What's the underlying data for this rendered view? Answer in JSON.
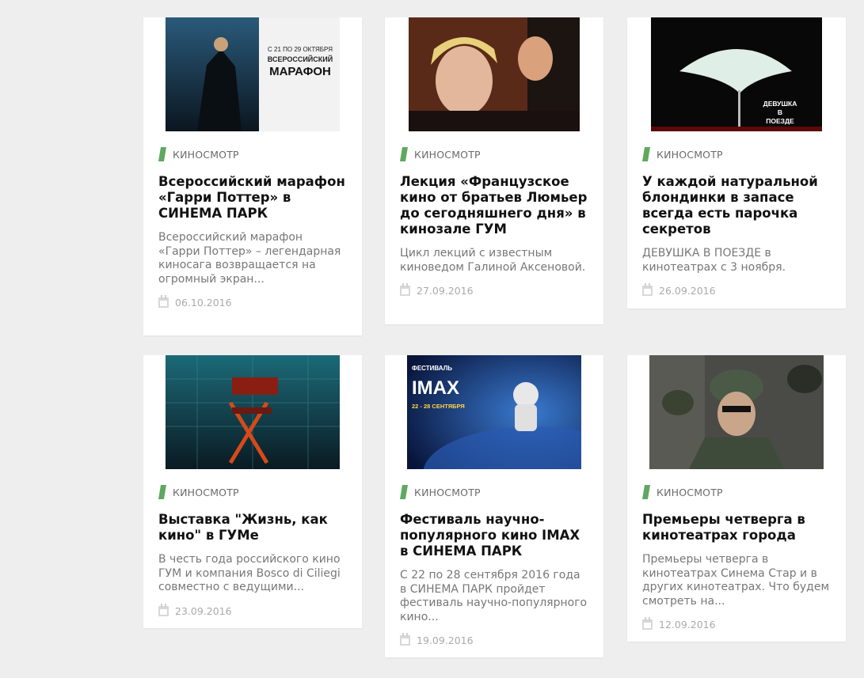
{
  "articles": [
    {
      "category": "КИНОСМОТР",
      "title": "Всероссийский марафон «Гарри Поттер» в СИНЕМА ПАРК",
      "description": "Всероссийский марафон «Гарри Поттер» – легендарная киносага возвращается на огромный экран...",
      "date": "06.10.2016",
      "image": {
        "line1": "С 21 ПО 29 ОКТЯБРЯ",
        "line2": "ВСЕРОССИЙСКИЙ",
        "line3": "МАРАФОН"
      }
    },
    {
      "category": "КИНОСМОТР",
      "title": "Лекция «Французское кино от братьев Люмьер до сегодняшнего дня» в кинозале ГУМ",
      "description": "Цикл лекций с известным киноведом Галиной Аксеновой.",
      "date": "27.09.2016"
    },
    {
      "category": "КИНОСМОТР",
      "title": "У каждой натуральной блондинки в запасе всегда есть парочка секретов",
      "description": "ДЕВУШКА В ПОЕЗДЕ в кинотеатрах с 3 ноября.",
      "date": "26.09.2016",
      "image": {
        "line1": "ДЕВУШКА",
        "line2": "В",
        "line3": "ПОЕЗДЕ"
      }
    },
    {
      "category": "КИНОСМОТР",
      "title": "Выставка \"Жизнь, как кино\" в ГУМе",
      "description": "В честь года российского кино ГУМ и компания Bosco di Ciliegi совместно с ведущими...",
      "date": "23.09.2016"
    },
    {
      "category": "КИНОСМОТР",
      "title": "Фестиваль научно-популярного кино IMAX в СИНЕМА ПАРК",
      "description": "С 22 по 28 сентября 2016 года в СИНЕМА ПАРК пройдет фестиваль научно-популярного кино...",
      "date": "19.09.2016",
      "image": {
        "line1": "ФЕСТИВАЛЬ",
        "line2": "IMAX",
        "line3": "22 - 28 СЕНТЯБРЯ"
      }
    },
    {
      "category": "КИНОСМОТР",
      "title": "Премьеры четверга в кинотеатрах города",
      "description": "Премьеры четверга в кинотеатрах Синема Стар и в других кинотеатрах. Что будем смотреть на...",
      "date": "12.09.2016"
    }
  ],
  "colors": {
    "accent": "#5fa860",
    "background": "#efeeee"
  },
  "icons": {
    "category": "category-flag-icon",
    "date": "calendar-icon"
  }
}
